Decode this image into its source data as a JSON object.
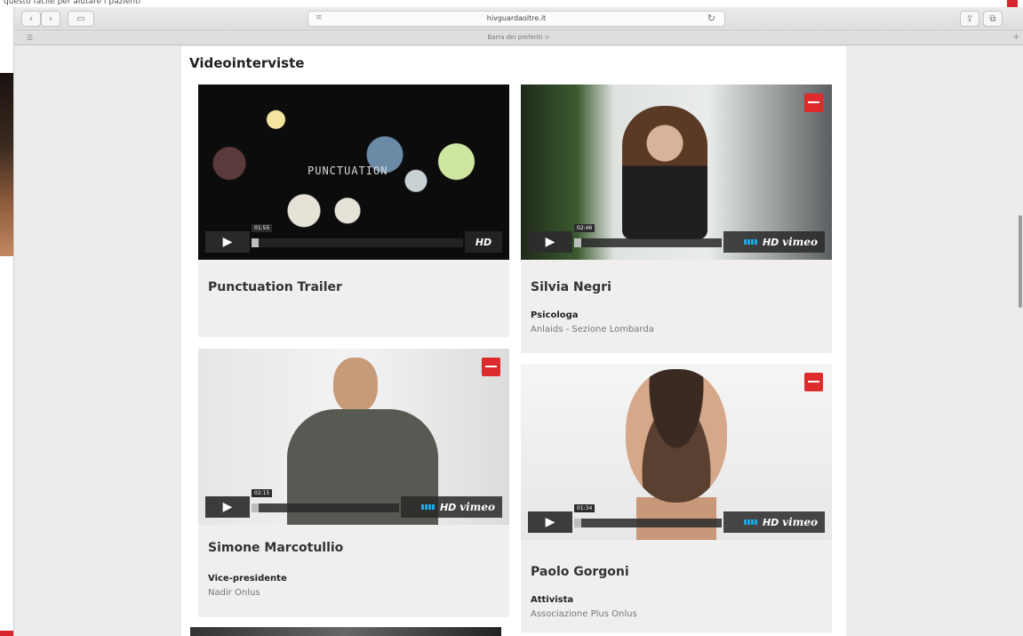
{
  "background": {
    "text": "questo facile per aiutare i pazienti"
  },
  "browser": {
    "url": "hivguardaoltre.it",
    "favorites_bar_label": "Barra dei preferiti >",
    "icons": {
      "back": "chevron-left-icon",
      "forward": "chevron-right-icon",
      "sidebar": "sidebar-icon",
      "reload": "reload-icon",
      "share": "share-icon",
      "tabs": "tabs-icon"
    }
  },
  "page": {
    "section_title": "Videointerviste",
    "videos": [
      {
        "title": "Punctuation Trailer",
        "role": "",
        "org": "",
        "duration": "01:55",
        "overlay_text": "PUNCTUATION",
        "player_badge": "HD"
      },
      {
        "title": "Silvia Negri",
        "role": "Psicologa",
        "org": "Anlaids - Sezione Lombarda",
        "duration": "02:46",
        "player_badge": "HD vimeo"
      },
      {
        "title": "Simone Marcotullio",
        "role": "Vice-presidente",
        "org": "Nadir Onlus",
        "duration": "02:15",
        "player_badge": "HD vimeo"
      },
      {
        "title": "Paolo Gorgoni",
        "role": "Attivista",
        "org": "Associazione Plus Onlus",
        "duration": "01:34",
        "player_badge": "HD vimeo"
      }
    ]
  },
  "colors": {
    "accent_red": "#dd2b2b",
    "vimeo_blue": "#18a9e6",
    "page_bg": "#ececeb",
    "card_bg": "#f0efee"
  }
}
